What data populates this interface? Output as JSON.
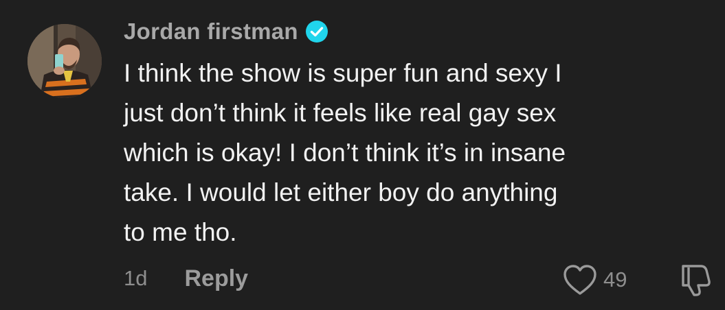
{
  "comment": {
    "username": "Jordan firstman",
    "verified": true,
    "text_lines": [
      "I think the show is super fun and sexy I",
      "just don’t think it feels like real gay sex",
      "which is okay! I don’t think it’s in insane",
      "take. I would let either boy do anything",
      "to me tho."
    ],
    "timestamp": "1d",
    "reply_label": "Reply",
    "like_count": "49"
  },
  "icons": {
    "verified": "verified-check-icon",
    "like": "heart-outline-icon",
    "dislike": "thumbs-down-outline-icon"
  },
  "colors": {
    "background": "#1f1f1f",
    "username": "#a9a9a9",
    "text": "#f2f2f2",
    "muted": "#8e8e8e",
    "verified_badge": "#20d5ec"
  }
}
